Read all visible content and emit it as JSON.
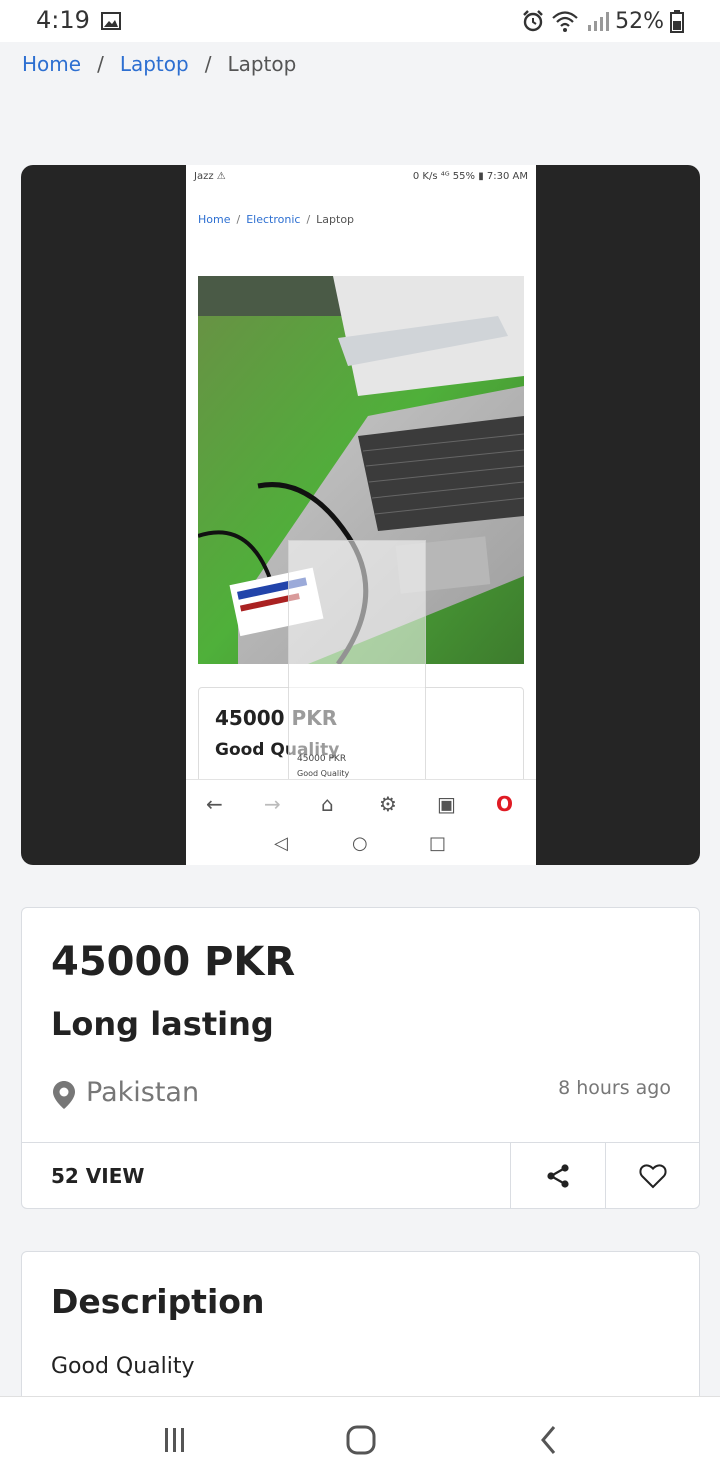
{
  "status_bar": {
    "time": "4:19",
    "battery": "52%"
  },
  "breadcrumb": {
    "home": "Home",
    "sep": "/",
    "category": "Laptop",
    "current": "Laptop"
  },
  "embedded": {
    "carrier": "Jazz ⚠",
    "status_right": "0 K/s ⁴ᴳ 55% ▮ 7:30 AM",
    "crumb_home": "Home",
    "crumb_cat": "Electronic",
    "crumb_cur": "Laptop",
    "sep": "/",
    "price": "45000 PKR",
    "quality": "Good Quality"
  },
  "listing": {
    "price": "45000 PKR",
    "title": "Long lasting",
    "location": "Pakistan",
    "posted": "8 hours ago",
    "views": "52 VIEW"
  },
  "description": {
    "heading": "Description",
    "text": "Good Quality"
  },
  "colors": {
    "link": "#2d6fd1",
    "accent_red": "#e01b24"
  }
}
